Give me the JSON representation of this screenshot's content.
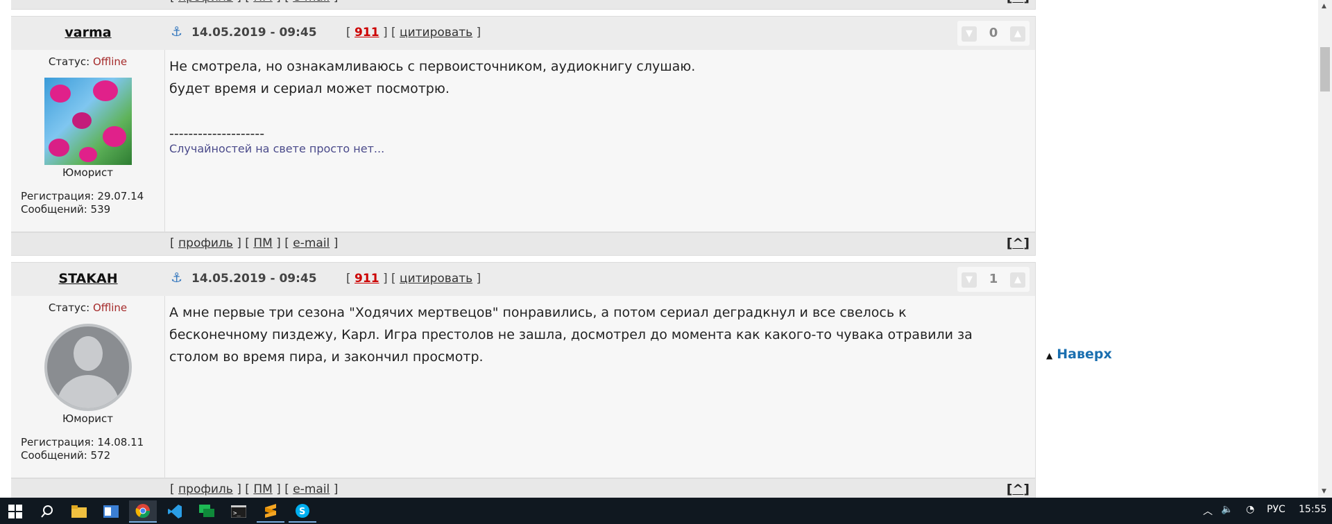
{
  "posts": [
    {
      "links": {
        "open": "[",
        "profile": "профиль",
        "pm": "ПМ",
        "email": "e-mail",
        "mid": "] [",
        "close": "]"
      },
      "top": "^",
      "nick": "varma",
      "date": "14.05.2019 - 09:45",
      "num": "911",
      "quote": "цитировать",
      "score": "0",
      "status_label": "Статус:",
      "status_value": "Offline",
      "rank": "Юморист",
      "reg": "Регистрация: 29.07.14",
      "msgs": "Сообщений: 539",
      "text_lines": [
        "Не смотрела, но ознакамливаюсь с первоисточником, аудиокнигу слушаю.",
        "будет время и сериал может посмотрю."
      ],
      "sig_dash": "--------------------",
      "signature": "Случайностей на свете просто нет..."
    },
    {
      "nick": "STAKAH",
      "date": "14.05.2019 - 09:45",
      "num": "911",
      "quote": "цитировать",
      "score": "1",
      "status_label": "Статус:",
      "status_value": "Offline",
      "rank": "Юморист",
      "reg": "Регистрация: 14.08.11",
      "msgs": "Сообщений: 572",
      "text_lines": [
        "А мне первые три сезона \"Ходячих мертвецов\" понравились, а потом сериал деградкнул и все свелось к",
        "бесконечному пиздежу, Карл. Игра престолов не зашла, досмотрел до момента как какого-то чувака отравили за",
        "столом во время пира, и закончил просмотр."
      ]
    }
  ],
  "back_to_top": "Наверх",
  "taskbar": {
    "lang": "РУС",
    "time": "15:55"
  },
  "colors": {
    "accent": "#1a6fb0",
    "offline": "#a52a2a",
    "number": "#cc0000"
  }
}
